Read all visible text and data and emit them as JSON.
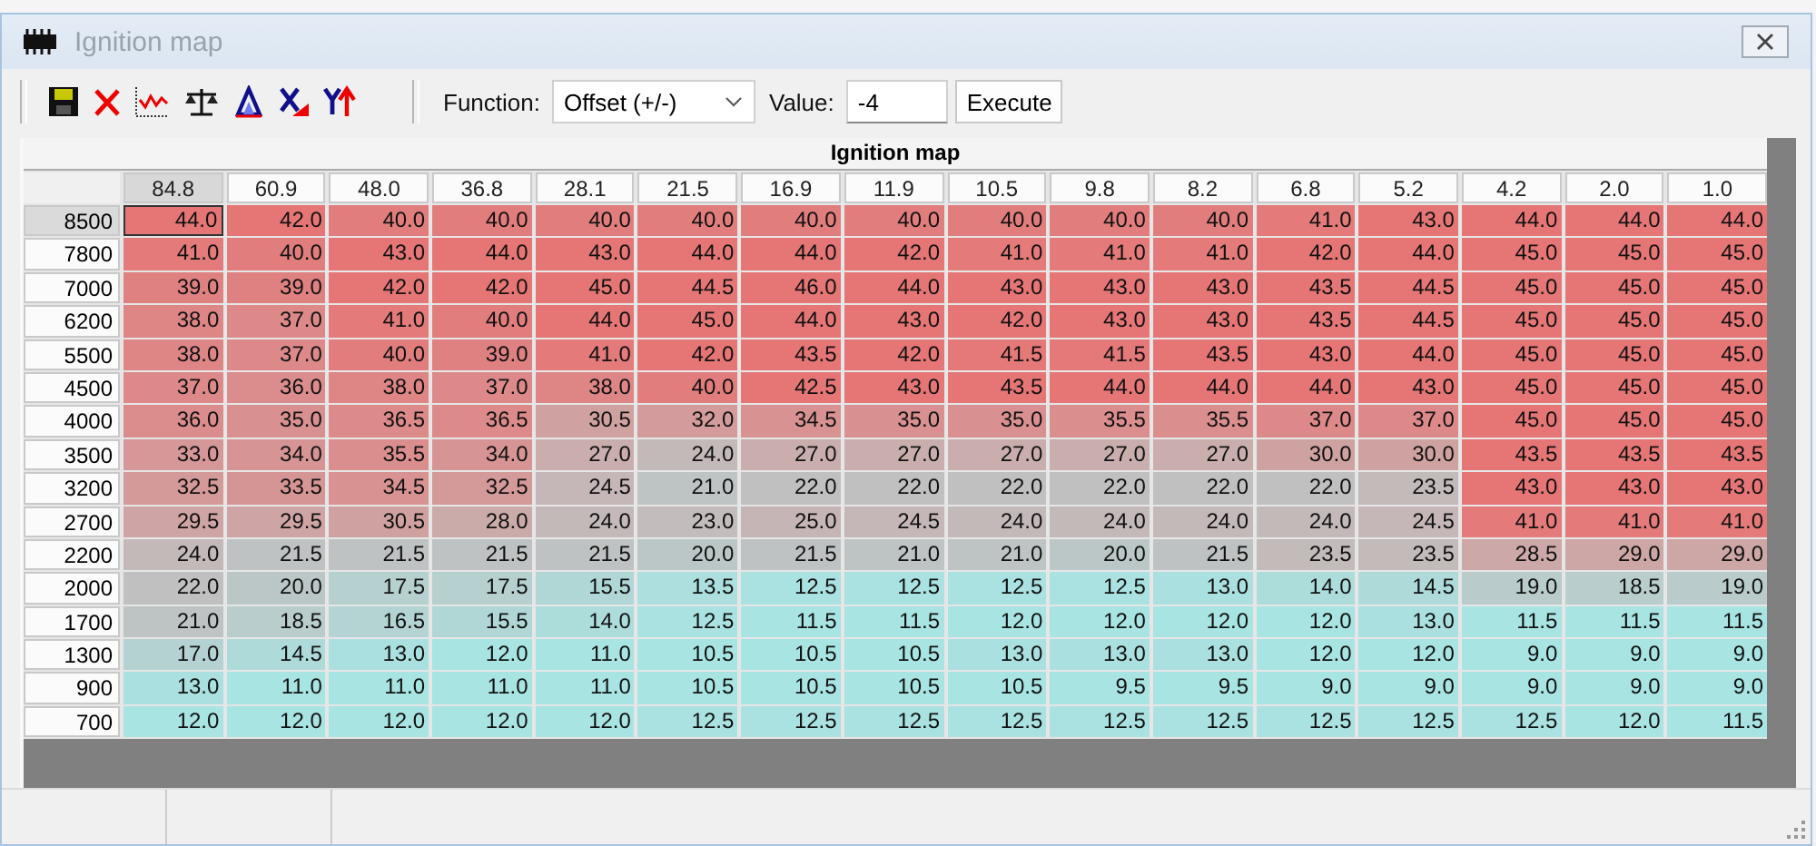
{
  "window": {
    "title": "Ignition map"
  },
  "toolbar": {
    "function_label": "Function:",
    "function_value": "Offset (+/-)",
    "value_label": "Value:",
    "value": "-4",
    "execute_button": "Execute"
  },
  "table": {
    "title": "Ignition map",
    "columns": [
      {
        "label": "84.8",
        "selected": true
      },
      {
        "label": "60.9",
        "selected": false
      },
      {
        "label": "48.0",
        "selected": false
      },
      {
        "label": "36.8",
        "selected": false
      },
      {
        "label": "28.1",
        "selected": false
      },
      {
        "label": "21.5",
        "selected": false
      },
      {
        "label": "16.9",
        "selected": false
      },
      {
        "label": "11.9",
        "selected": false
      },
      {
        "label": "10.5",
        "selected": false
      },
      {
        "label": "9.8",
        "selected": false
      },
      {
        "label": "8.2",
        "selected": false
      },
      {
        "label": "6.8",
        "selected": false
      },
      {
        "label": "5.2",
        "selected": false
      },
      {
        "label": "4.2",
        "selected": false
      },
      {
        "label": "2.0",
        "selected": false
      },
      {
        "label": "1.0",
        "selected": false
      }
    ],
    "rows": [
      {
        "label": "8500",
        "selected": true,
        "values": [
          "44.0",
          "42.0",
          "40.0",
          "40.0",
          "40.0",
          "40.0",
          "40.0",
          "40.0",
          "40.0",
          "40.0",
          "40.0",
          "41.0",
          "43.0",
          "44.0",
          "44.0",
          "44.0"
        ]
      },
      {
        "label": "7800",
        "selected": false,
        "values": [
          "41.0",
          "40.0",
          "43.0",
          "44.0",
          "43.0",
          "44.0",
          "44.0",
          "42.0",
          "41.0",
          "41.0",
          "41.0",
          "42.0",
          "44.0",
          "45.0",
          "45.0",
          "45.0"
        ]
      },
      {
        "label": "7000",
        "selected": false,
        "values": [
          "39.0",
          "39.0",
          "42.0",
          "42.0",
          "45.0",
          "44.5",
          "46.0",
          "44.0",
          "43.0",
          "43.0",
          "43.0",
          "43.5",
          "44.5",
          "45.0",
          "45.0",
          "45.0"
        ]
      },
      {
        "label": "6200",
        "selected": false,
        "values": [
          "38.0",
          "37.0",
          "41.0",
          "40.0",
          "44.0",
          "45.0",
          "44.0",
          "43.0",
          "42.0",
          "43.0",
          "43.0",
          "43.5",
          "44.5",
          "45.0",
          "45.0",
          "45.0"
        ]
      },
      {
        "label": "5500",
        "selected": false,
        "values": [
          "38.0",
          "37.0",
          "40.0",
          "39.0",
          "41.0",
          "42.0",
          "43.5",
          "42.0",
          "41.5",
          "41.5",
          "43.5",
          "43.0",
          "44.0",
          "45.0",
          "45.0",
          "45.0"
        ]
      },
      {
        "label": "4500",
        "selected": false,
        "values": [
          "37.0",
          "36.0",
          "38.0",
          "37.0",
          "38.0",
          "40.0",
          "42.5",
          "43.0",
          "43.5",
          "44.0",
          "44.0",
          "44.0",
          "43.0",
          "45.0",
          "45.0",
          "45.0"
        ]
      },
      {
        "label": "4000",
        "selected": false,
        "values": [
          "36.0",
          "35.0",
          "36.5",
          "36.5",
          "30.5",
          "32.0",
          "34.5",
          "35.0",
          "35.0",
          "35.5",
          "35.5",
          "37.0",
          "37.0",
          "45.0",
          "45.0",
          "45.0"
        ]
      },
      {
        "label": "3500",
        "selected": false,
        "values": [
          "33.0",
          "34.0",
          "35.5",
          "34.0",
          "27.0",
          "24.0",
          "27.0",
          "27.0",
          "27.0",
          "27.0",
          "27.0",
          "30.0",
          "30.0",
          "43.5",
          "43.5",
          "43.5"
        ]
      },
      {
        "label": "3200",
        "selected": false,
        "values": [
          "32.5",
          "33.5",
          "34.5",
          "32.5",
          "24.5",
          "21.0",
          "22.0",
          "22.0",
          "22.0",
          "22.0",
          "22.0",
          "22.0",
          "23.5",
          "43.0",
          "43.0",
          "43.0"
        ]
      },
      {
        "label": "2700",
        "selected": false,
        "values": [
          "29.5",
          "29.5",
          "30.5",
          "28.0",
          "24.0",
          "23.0",
          "25.0",
          "24.5",
          "24.0",
          "24.0",
          "24.0",
          "24.0",
          "24.5",
          "41.0",
          "41.0",
          "41.0"
        ]
      },
      {
        "label": "2200",
        "selected": false,
        "values": [
          "24.0",
          "21.5",
          "21.5",
          "21.5",
          "21.5",
          "20.0",
          "21.5",
          "21.0",
          "21.0",
          "20.0",
          "21.5",
          "23.5",
          "23.5",
          "28.5",
          "29.0",
          "29.0"
        ]
      },
      {
        "label": "2000",
        "selected": false,
        "values": [
          "22.0",
          "20.0",
          "17.5",
          "17.5",
          "15.5",
          "13.5",
          "12.5",
          "12.5",
          "12.5",
          "12.5",
          "13.0",
          "14.0",
          "14.5",
          "19.0",
          "18.5",
          "19.0"
        ]
      },
      {
        "label": "1700",
        "selected": false,
        "values": [
          "21.0",
          "18.5",
          "16.5",
          "15.5",
          "14.0",
          "12.5",
          "11.5",
          "11.5",
          "12.0",
          "12.0",
          "12.0",
          "12.0",
          "13.0",
          "11.5",
          "11.5",
          "11.5"
        ]
      },
      {
        "label": "1300",
        "selected": false,
        "values": [
          "17.0",
          "14.5",
          "13.0",
          "12.0",
          "11.0",
          "10.5",
          "10.5",
          "10.5",
          "13.0",
          "13.0",
          "13.0",
          "12.0",
          "12.0",
          "9.0",
          "9.0",
          "9.0"
        ]
      },
      {
        "label": "900",
        "selected": false,
        "values": [
          "13.0",
          "11.0",
          "11.0",
          "11.0",
          "11.0",
          "10.5",
          "10.5",
          "10.5",
          "10.5",
          "9.5",
          "9.5",
          "9.0",
          "9.0",
          "9.0",
          "9.0",
          "9.0"
        ]
      },
      {
        "label": "700",
        "selected": false,
        "values": [
          "12.0",
          "12.0",
          "12.0",
          "12.0",
          "12.0",
          "12.5",
          "12.5",
          "12.5",
          "12.5",
          "12.5",
          "12.5",
          "12.5",
          "12.5",
          "12.5",
          "12.0",
          "11.5"
        ]
      }
    ]
  }
}
